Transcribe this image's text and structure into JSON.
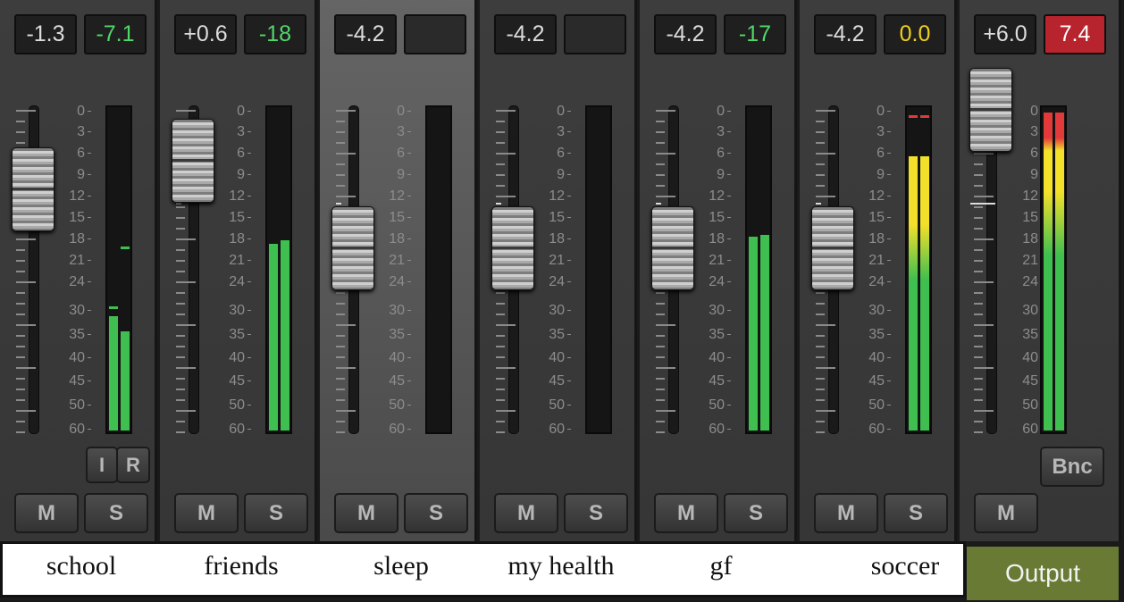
{
  "channels": [
    {
      "name": "school",
      "volume": "-1.3",
      "peak": "-7.1",
      "peak_style": "green",
      "fader_db": -11,
      "meter_levels": [
        -31,
        -34
      ],
      "meter_peaks": [
        -29,
        -19
      ],
      "buttons": {
        "input": "I",
        "record": "R",
        "mute": "M",
        "solo": "S"
      },
      "selected": false
    },
    {
      "name": "friends",
      "volume": "+0.6",
      "peak": "-18",
      "peak_style": "green",
      "fader_db": -7,
      "meter_levels": [
        -18.5,
        -18
      ],
      "meter_peaks": [],
      "buttons": {
        "mute": "M",
        "solo": "S"
      },
      "selected": false
    },
    {
      "name": "sleep",
      "volume": "-4.2",
      "peak": "",
      "peak_style": "blank",
      "fader_db": -18,
      "meter_levels": [],
      "meter_peaks": [],
      "buttons": {
        "mute": "M",
        "solo": "S"
      },
      "selected": true
    },
    {
      "name": "my health",
      "volume": "-4.2",
      "peak": "",
      "peak_style": "blank",
      "fader_db": -18,
      "meter_levels": [],
      "meter_peaks": [],
      "buttons": {
        "mute": "M",
        "solo": "S"
      },
      "selected": false
    },
    {
      "name": "gf",
      "volume": "-4.2",
      "peak": "-17",
      "peak_style": "green",
      "fader_db": -18,
      "meter_levels": [
        -17.5,
        -17.3
      ],
      "meter_peaks": [],
      "buttons": {
        "mute": "M",
        "solo": "S"
      },
      "selected": false
    },
    {
      "name": "soccer",
      "volume": "-4.2",
      "peak": "0.0",
      "peak_style": "yellow",
      "fader_db": -18,
      "meter_levels": [
        -6.2,
        -6.2
      ],
      "meter_peaks": [
        -0.5,
        -0.5
      ],
      "buttons": {
        "mute": "M",
        "solo": "S"
      },
      "selected": false
    }
  ],
  "master": {
    "name": "Output",
    "volume": "+6.0",
    "peak": "7.4",
    "peak_style": "red",
    "fader_db": 0,
    "meter_levels": [
      0,
      0
    ],
    "meter_peaks": [],
    "buttons": {
      "bounce": "Bnc",
      "mute": "M"
    }
  },
  "scale_labels": [
    "0",
    "3",
    "6",
    "9",
    "12",
    "15",
    "18",
    "21",
    "24",
    "30",
    "35",
    "40",
    "45",
    "50",
    "60"
  ],
  "colors": {
    "meter_green": "#3fbf4f",
    "meter_yellow": "#f2e02a",
    "meter_red": "#e23a3a",
    "strip": "#3b3b3b",
    "selected_strip": "#5e5e5e",
    "output_label_bg": "#687a33"
  }
}
